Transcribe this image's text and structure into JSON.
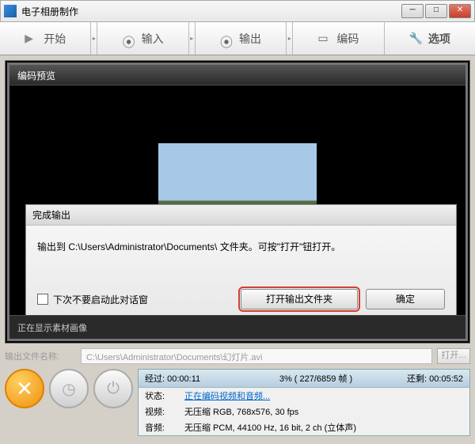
{
  "window": {
    "title": "电子相册制作"
  },
  "toolbar": {
    "start": "开始",
    "input": "输入",
    "output": "输出",
    "encode": "编码",
    "options": "选项"
  },
  "preview": {
    "header": "编码预览",
    "status": "正在显示素材画像"
  },
  "output_file": {
    "label": "输出文件名称:",
    "path": "C:\\Users\\Administrator\\Documents\\幻灯片.avi",
    "open_label": "打开..."
  },
  "progress": {
    "elapsed_label": "经过:",
    "elapsed_value": "00:00:11",
    "percent": "3% ( 227/6859 帧 )",
    "remain_label": "还剩:",
    "remain_value": "00:05:52",
    "status_label": "状态:",
    "status_value": "正在编码视频和音频...",
    "video_label": "视频:",
    "video_value": "无压缩 RGB, 768x576, 30 fps",
    "audio_label": "音频:",
    "audio_value": "无压缩 PCM, 44100 Hz, 16 bit, 2 ch (立体声)"
  },
  "dialog": {
    "title": "完成输出",
    "message": "输出到 C:\\Users\\Administrator\\Documents\\ 文件夹。可按\"打开\"钮打开。",
    "checkbox_label": "下次不要启动此对话窗",
    "open_button": "打开输出文件夹",
    "ok_button": "确定"
  }
}
